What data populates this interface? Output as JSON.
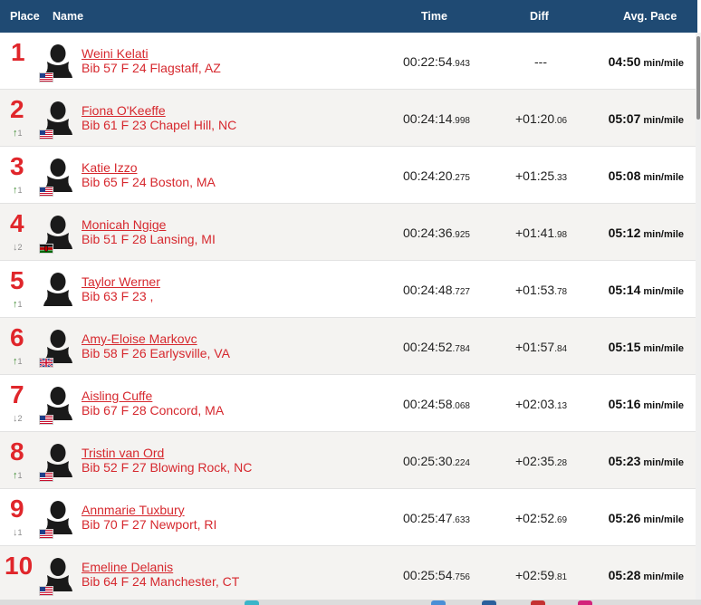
{
  "header": {
    "place": "Place",
    "name": "Name",
    "time": "Time",
    "diff": "Diff",
    "pace": "Avg. Pace"
  },
  "pace_unit": "min/mile",
  "colors": {
    "header_bg": "#1f4a73",
    "accent_red": "#e0262b",
    "link_red": "#d6282e",
    "up_green": "#3a8a2e",
    "down_grey": "#8a8a8a"
  },
  "rows": [
    {
      "place": "1",
      "change_dir": "",
      "change": "",
      "flag": "us-flag-icon",
      "name": "Weini Kelati",
      "info": "Bib 57 F 24 Flagstaff, AZ",
      "time": "00:22:54",
      "time_ms": ".943",
      "diff": "---",
      "diff_ms": "",
      "pace": "04:50"
    },
    {
      "place": "2",
      "change_dir": "up",
      "change": "1",
      "flag": "us-flag-icon",
      "name": "Fiona O'Keeffe",
      "info": "Bib 61 F 23 Chapel Hill, NC",
      "time": "00:24:14",
      "time_ms": ".998",
      "diff": "+01:20",
      "diff_ms": ".06",
      "pace": "05:07"
    },
    {
      "place": "3",
      "change_dir": "up",
      "change": "1",
      "flag": "us-flag-icon",
      "name": "Katie Izzo",
      "info": "Bib 65 F 24 Boston, MA",
      "time": "00:24:20",
      "time_ms": ".275",
      "diff": "+01:25",
      "diff_ms": ".33",
      "pace": "05:08"
    },
    {
      "place": "4",
      "change_dir": "down",
      "change": "2",
      "flag": "kenya-flag-icon",
      "name": "Monicah Ngige",
      "info": "Bib 51 F 28 Lansing, MI",
      "time": "00:24:36",
      "time_ms": ".925",
      "diff": "+01:41",
      "diff_ms": ".98",
      "pace": "05:12"
    },
    {
      "place": "5",
      "change_dir": "up",
      "change": "1",
      "flag": "",
      "name": "Taylor Werner",
      "info": "Bib 63 F 23 ,",
      "time": "00:24:48",
      "time_ms": ".727",
      "diff": "+01:53",
      "diff_ms": ".78",
      "pace": "05:14"
    },
    {
      "place": "6",
      "change_dir": "up",
      "change": "1",
      "flag": "uk-flag-icon",
      "name": "Amy-Eloise Markovc",
      "info": "Bib 58 F 26 Earlysville, VA",
      "time": "00:24:52",
      "time_ms": ".784",
      "diff": "+01:57",
      "diff_ms": ".84",
      "pace": "05:15"
    },
    {
      "place": "7",
      "change_dir": "down",
      "change": "2",
      "flag": "us-flag-icon",
      "name": "Aisling Cuffe",
      "info": "Bib 67 F 28 Concord, MA",
      "time": "00:24:58",
      "time_ms": ".068",
      "diff": "+02:03",
      "diff_ms": ".13",
      "pace": "05:16"
    },
    {
      "place": "8",
      "change_dir": "up",
      "change": "1",
      "flag": "us-flag-icon",
      "name": "Tristin van Ord",
      "info": "Bib 52 F 27 Blowing Rock, NC",
      "time": "00:25:30",
      "time_ms": ".224",
      "diff": "+02:35",
      "diff_ms": ".28",
      "pace": "05:23"
    },
    {
      "place": "9",
      "change_dir": "down",
      "change": "1",
      "flag": "us-flag-icon",
      "name": "Annmarie Tuxbury",
      "info": "Bib 70 F 27 Newport, RI",
      "time": "00:25:47",
      "time_ms": ".633",
      "diff": "+02:52",
      "diff_ms": ".69",
      "pace": "05:26"
    },
    {
      "place": "10",
      "change_dir": "",
      "change": "",
      "flag": "us-flag-icon",
      "name": "Emeline Delanis",
      "info": "Bib 64 F 24 Manchester, CT",
      "time": "00:25:54",
      "time_ms": ".756",
      "diff": "+02:59",
      "diff_ms": ".81",
      "pace": "05:28"
    }
  ]
}
